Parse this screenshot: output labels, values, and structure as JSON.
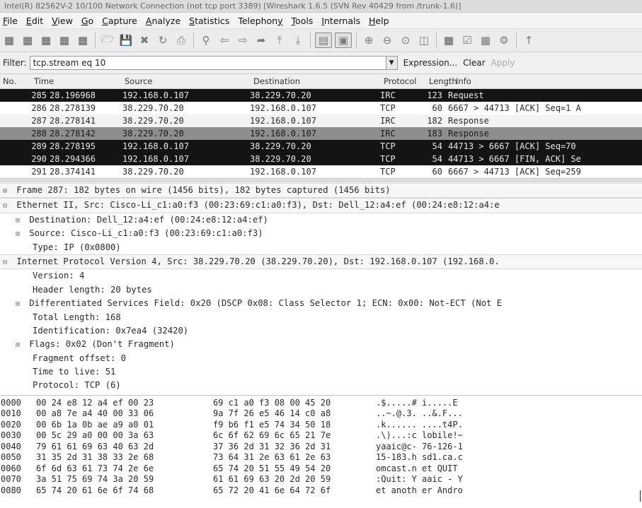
{
  "title": "Intel(R) 82562V-2 10/100 Network Connection (not tcp port 3389)   [Wireshark 1.6.5  (SVN Rev 40429 from /trunk-1.6)]",
  "menu": [
    {
      "pre": "",
      "ul": "F",
      "post": "ile"
    },
    {
      "pre": "",
      "ul": "E",
      "post": "dit"
    },
    {
      "pre": "",
      "ul": "V",
      "post": "iew"
    },
    {
      "pre": "",
      "ul": "G",
      "post": "o"
    },
    {
      "pre": "",
      "ul": "C",
      "post": "apture"
    },
    {
      "pre": "",
      "ul": "A",
      "post": "nalyze"
    },
    {
      "pre": "",
      "ul": "S",
      "post": "tatistics"
    },
    {
      "pre": "Telephon",
      "ul": "y",
      "post": ""
    },
    {
      "pre": "",
      "ul": "T",
      "post": "ools"
    },
    {
      "pre": "",
      "ul": "I",
      "post": "nternals"
    },
    {
      "pre": "",
      "ul": "H",
      "post": "elp"
    }
  ],
  "filter": {
    "label": "Filter:",
    "value": "tcp.stream eq 10",
    "expression": "Expression...",
    "clear": "Clear",
    "apply": "Apply"
  },
  "columns": {
    "no": "No.",
    "time": "Time",
    "source": "Source",
    "destination": "Destination",
    "protocol": "Protocol",
    "length": "Length",
    "info": "Info"
  },
  "packets": [
    {
      "no": "285",
      "time": "28.196968",
      "src": "192.168.0.107",
      "dst": "38.229.70.20",
      "proto": "IRC",
      "len": "123",
      "info": "Request",
      "style": "row-black"
    },
    {
      "no": "286",
      "time": "28.278139",
      "src": "38.229.70.20",
      "dst": "192.168.0.107",
      "proto": "TCP",
      "len": "60",
      "info": "6667 > 44713 [ACK] Seq=1 A",
      "style": "row-white"
    },
    {
      "no": "287",
      "time": "28.278141",
      "src": "38.229.70.20",
      "dst": "192.168.0.107",
      "proto": "IRC",
      "len": "182",
      "info": "Response",
      "style": "row-light"
    },
    {
      "no": "288",
      "time": "28.278142",
      "src": "38.229.70.20",
      "dst": "192.168.0.107",
      "proto": "IRC",
      "len": "183",
      "info": "Response",
      "style": "row-gray"
    },
    {
      "no": "289",
      "time": "28.278195",
      "src": "192.168.0.107",
      "dst": "38.229.70.20",
      "proto": "TCP",
      "len": "54",
      "info": "44713 > 6667 [ACK] Seq=70",
      "style": "row-black"
    },
    {
      "no": "290",
      "time": "28.294366",
      "src": "192.168.0.107",
      "dst": "38.229.70.20",
      "proto": "TCP",
      "len": "54",
      "info": "44713 > 6667 [FIN, ACK] Se",
      "style": "row-black"
    },
    {
      "no": "291",
      "time": "28.374141",
      "src": "38.229.70.20",
      "dst": "192.168.0.107",
      "proto": "TCP",
      "len": "60",
      "info": "6667 > 44713 [ACK] Seq=259",
      "style": "row-white"
    }
  ],
  "details": [
    {
      "text": "Frame 287: 182 bytes on wire (1456 bits), 182 bytes captured (1456 bits)",
      "level": 0,
      "expander": "+",
      "top": true
    },
    {
      "text": "Ethernet II, Src: Cisco-Li_c1:a0:f3 (00:23:69:c1:a0:f3), Dst: Dell_12:a4:ef (00:24:e8:12:a4:e",
      "level": 0,
      "expander": "-",
      "top": true
    },
    {
      "text": "Destination: Dell_12:a4:ef (00:24:e8:12:a4:ef)",
      "level": 1,
      "expander": "+"
    },
    {
      "text": "Source: Cisco-Li_c1:a0:f3 (00:23:69:c1:a0:f3)",
      "level": 1,
      "expander": "+"
    },
    {
      "text": "Type: IP (0x0800)",
      "level": 2,
      "expander": ""
    },
    {
      "text": "Internet Protocol Version 4, Src: 38.229.70.20 (38.229.70.20), Dst: 192.168.0.107 (192.168.0.",
      "level": 0,
      "expander": "-",
      "top": true
    },
    {
      "text": "Version: 4",
      "level": 2,
      "expander": ""
    },
    {
      "text": "Header length: 20 bytes",
      "level": 2,
      "expander": ""
    },
    {
      "text": "Differentiated Services Field: 0x20 (DSCP 0x08: Class Selector 1; ECN: 0x00: Not-ECT (Not E",
      "level": 1,
      "expander": "+"
    },
    {
      "text": "Total Length: 168",
      "level": 2,
      "expander": ""
    },
    {
      "text": "Identification: 0x7ea4 (32420)",
      "level": 2,
      "expander": ""
    },
    {
      "text": "Flags: 0x02 (Don't Fragment)",
      "level": 1,
      "expander": "+"
    },
    {
      "text": "Fragment offset: 0",
      "level": 2,
      "expander": ""
    },
    {
      "text": "Time to live: 51",
      "level": 2,
      "expander": ""
    },
    {
      "text": "Protocol: TCP (6)",
      "level": 2,
      "expander": ""
    }
  ],
  "hex": [
    {
      "off": "0000",
      "b1": "00 24 e8 12 a4 ef 00 23",
      "b2": "69 c1 a0 f3 08 00 45 20",
      "ascii": ".$.....# i.....E "
    },
    {
      "off": "0010",
      "b1": "00 a8 7e a4 40 00 33 06",
      "b2": "9a 7f 26 e5 46 14 c0 a8",
      "ascii": "..~.@.3. ..&.F..."
    },
    {
      "off": "0020",
      "b1": "00 6b 1a 0b ae a9 a0 01",
      "b2": "f9 b6 f1 e5 74 34 50 18",
      "ascii": ".k...... ....t4P."
    },
    {
      "off": "0030",
      "b1": "00 5c 29 a0 00 00 3a 63",
      "b2": "6c 6f 62 69 6c 65 21 7e",
      "ascii": ".\\)...:c lobile!~"
    },
    {
      "off": "0040",
      "b1": "79 61 61 69 63 40 63 2d",
      "b2": "37 36 2d 31 32 36 2d 31",
      "ascii": "yaaic@c- 76-126-1"
    },
    {
      "off": "0050",
      "b1": "31 35 2d 31 38 33 2e 68",
      "b2": "73 64 31 2e 63 61 2e 63",
      "ascii": "15-183.h sd1.ca.c"
    },
    {
      "off": "0060",
      "b1": "6f 6d 63 61 73 74 2e 6e",
      "b2": "65 74 20 51 55 49 54 20",
      "ascii": "omcast.n et QUIT "
    },
    {
      "off": "0070",
      "b1": "3a 51 75 69 74 3a 20 59",
      "b2": "61 61 69 63 20 2d 20 59",
      "ascii": ":Quit: Y aaic - Y"
    },
    {
      "off": "0080",
      "b1": "65 74 20 61 6e 6f 74 68",
      "b2": "65 72 20 41 6e 64 72 6f",
      "ascii": "et anoth er Andro"
    }
  ]
}
